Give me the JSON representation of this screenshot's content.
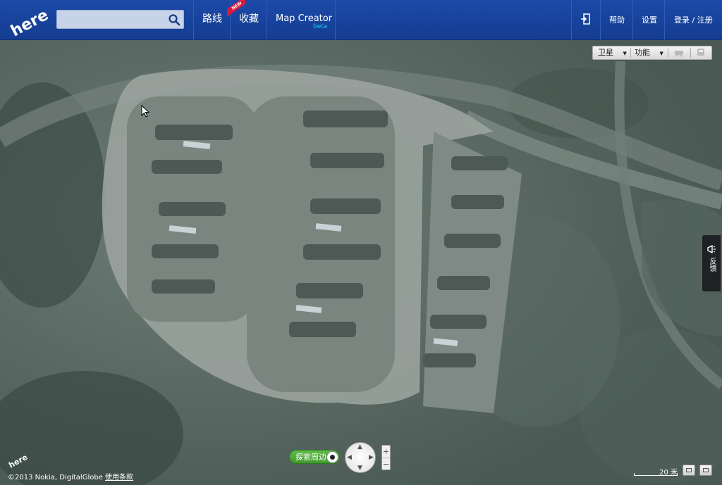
{
  "header": {
    "logo_text": "here",
    "search": {
      "placeholder": "",
      "value": ""
    },
    "nav": {
      "routes": "路线",
      "favorites": "收藏",
      "favorites_badge": "NEW",
      "map_creator": "Map Creator",
      "map_creator_tag": "beta"
    },
    "right": {
      "help": "帮助",
      "settings": "设置",
      "login": "登录 / 注册"
    }
  },
  "map": {
    "toolbar": {
      "satellite": "卫星",
      "features": "功能"
    },
    "feedback": "反馈",
    "explore_nearby": "探索周边",
    "zoom_in": "+",
    "zoom_out": "−",
    "scale": "20 米",
    "copyright": "©2013 Nokia, DigitalGlobe",
    "terms": "使用条款",
    "watermark_logo": "here"
  },
  "colors": {
    "header_blue": "#1a47a3",
    "beta_cyan": "#28c4f5",
    "new_badge_red": "#d81c3f",
    "explore_green": "#4caa38"
  }
}
